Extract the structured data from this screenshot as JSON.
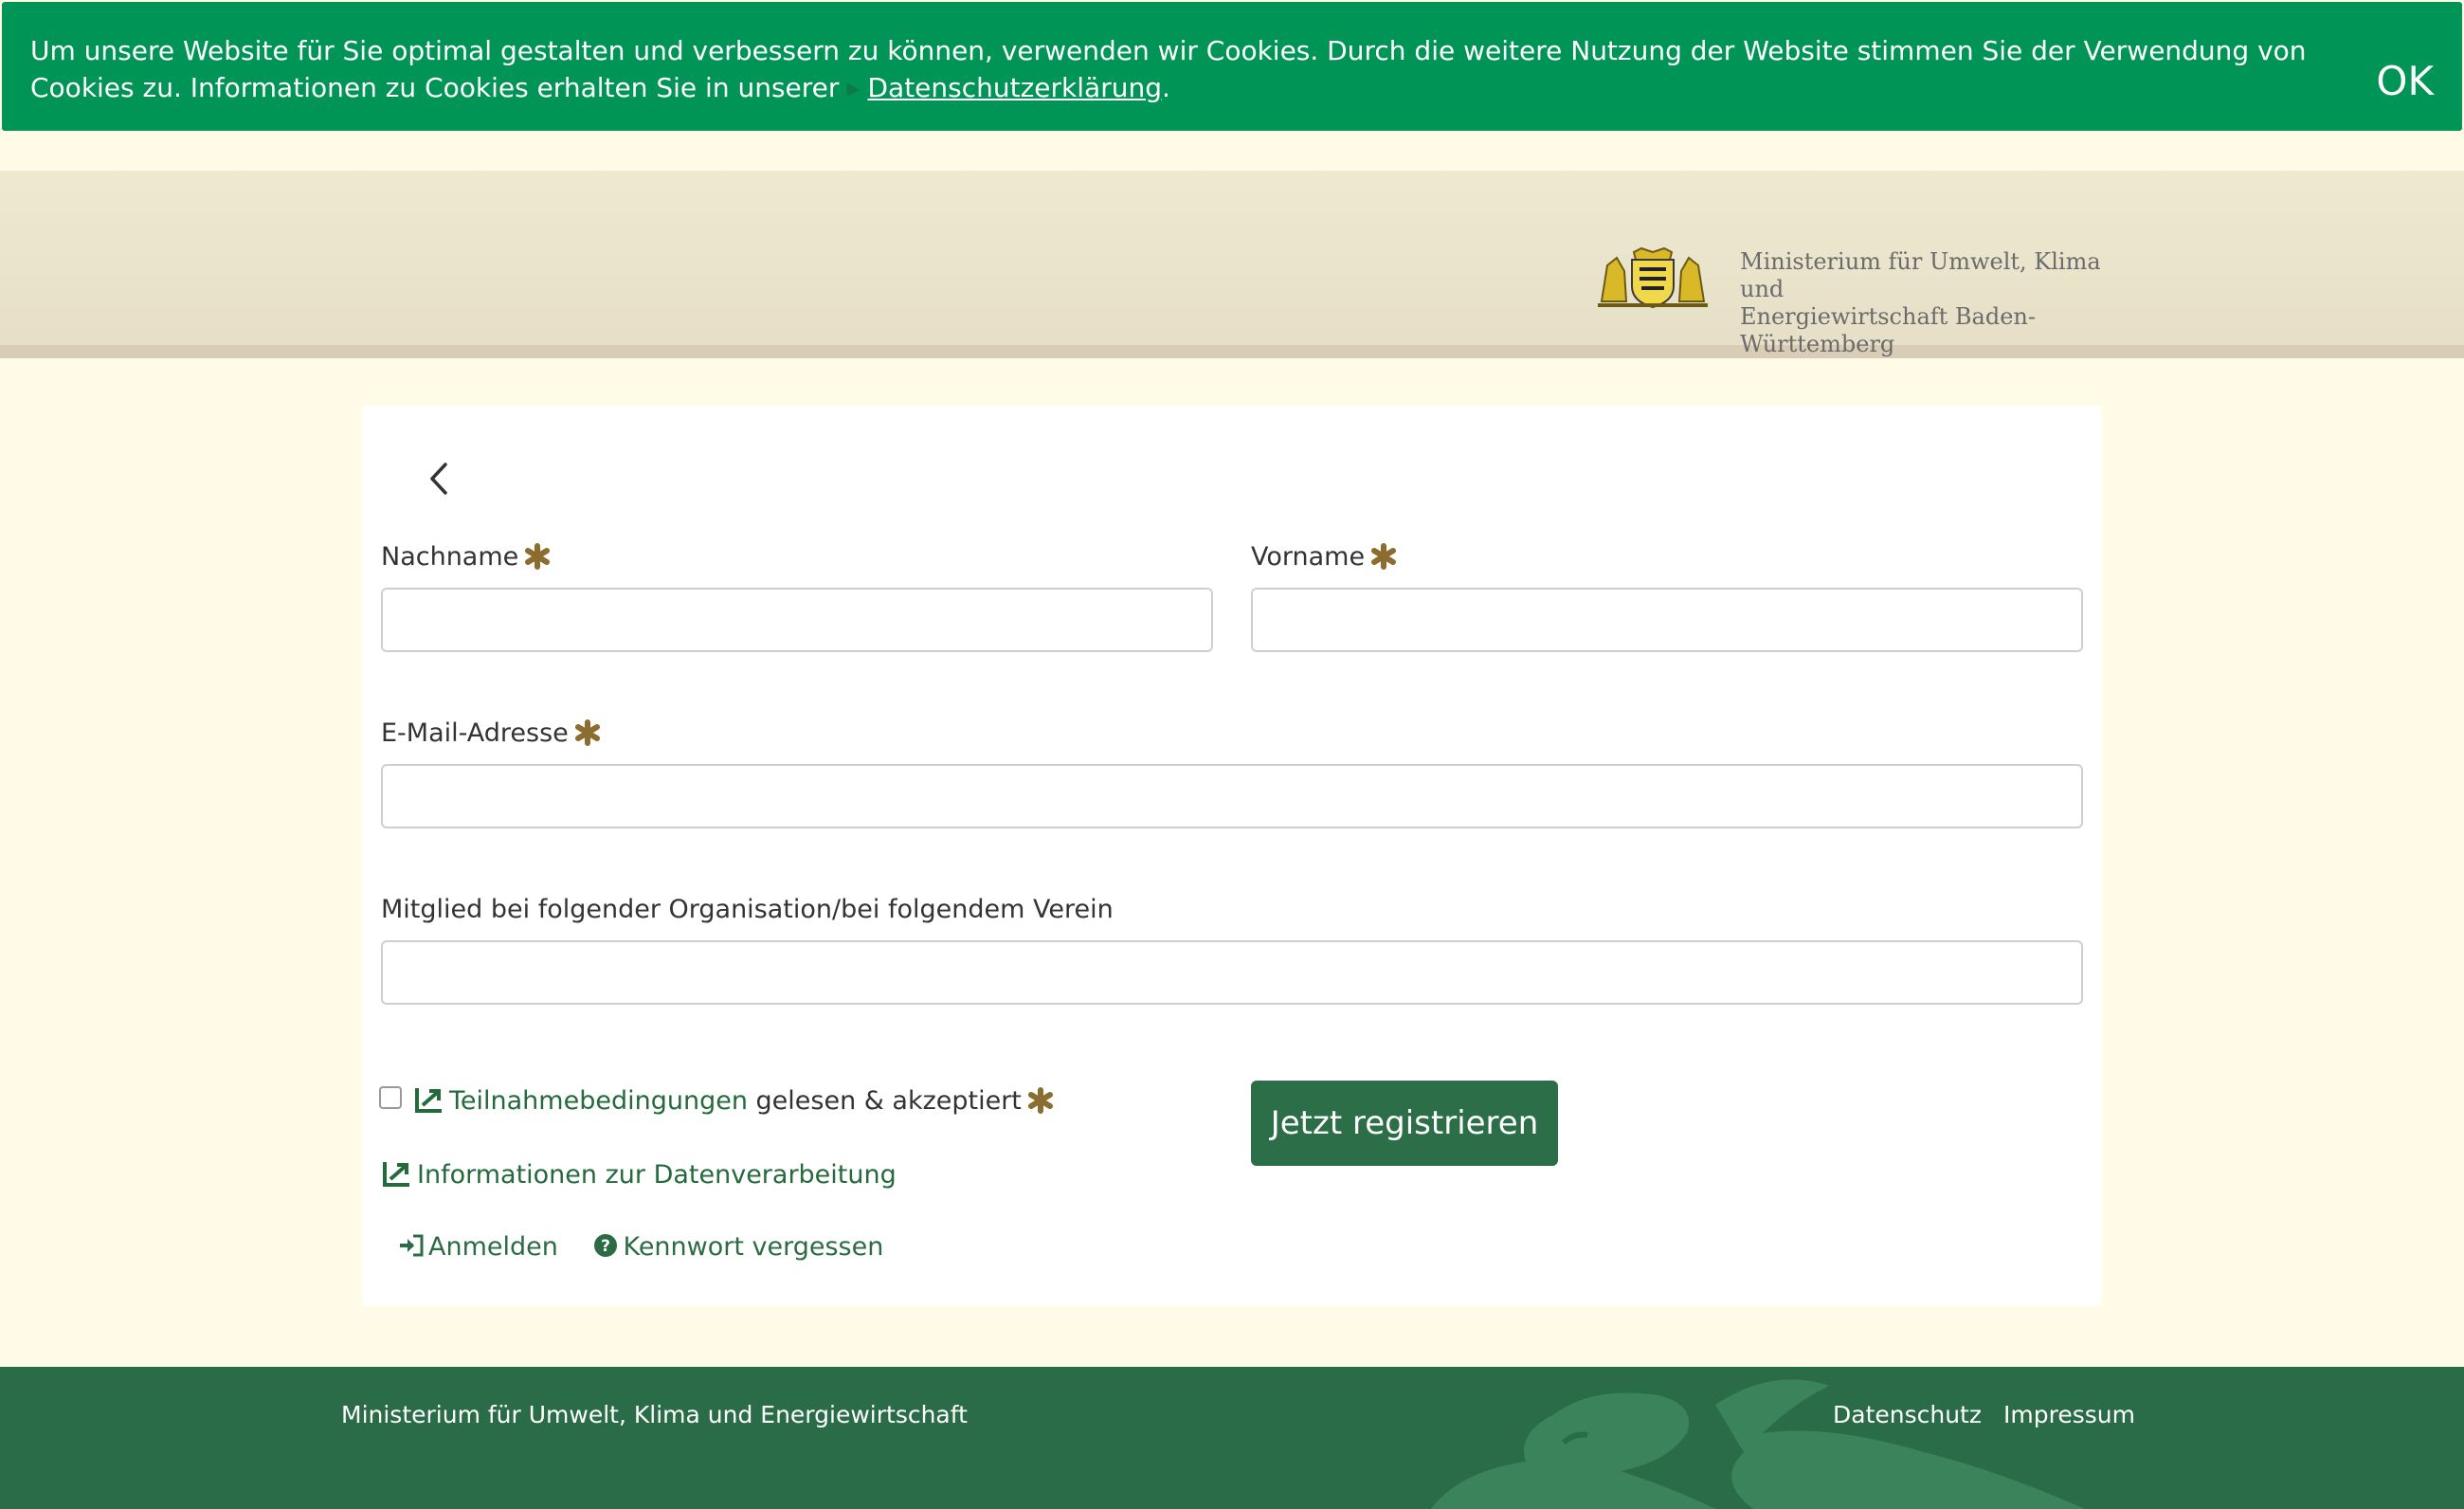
{
  "cookie_banner": {
    "text": "Um unsere Website für Sie optimal gestalten und verbessern zu können, verwenden wir Cookies. Durch die weitere Nutzung der Website stimmen Sie der Verwendung von Cookies zu. Informationen zu Cookies erhalten Sie in unserer",
    "link_label": "Datenschutzerklärung",
    "period": ".",
    "ok_label": "OK"
  },
  "header": {
    "ministry_line1": "Ministerium für Umwelt, Klima und",
    "ministry_line2": "Energiewirtschaft Baden-Württemberg"
  },
  "form": {
    "last_name_label": "Nachname",
    "first_name_label": "Vorname",
    "email_label": "E-Mail-Adresse",
    "organization_label": "Mitglied bei folgender Organisation/bei folgendem Verein",
    "last_name_value": "",
    "first_name_value": "",
    "email_value": "",
    "organization_value": "",
    "terms_link_label": "Teilnahmebedingungen",
    "terms_suffix": "gelesen & akzeptiert",
    "data_processing_label": "Informationen zur Datenverarbeitung",
    "register_button_label": "Jetzt registrieren",
    "login_label": "Anmelden",
    "forgot_password_label": "Kennwort vergessen"
  },
  "footer": {
    "title": "Ministerium für Umwelt, Klima und Energiewirtschaft",
    "privacy_label": "Datenschutz",
    "imprint_label": "Impressum"
  },
  "colors": {
    "banner_green": "#009456",
    "brand_green": "#2b6e48",
    "star_gold": "#8a6d2f",
    "page_bg": "#fffbe6"
  },
  "icons": {
    "back": "chevron-left-icon",
    "required": "asterisk-icon",
    "external": "external-link-icon",
    "login": "sign-in-icon",
    "help": "question-circle-icon"
  }
}
